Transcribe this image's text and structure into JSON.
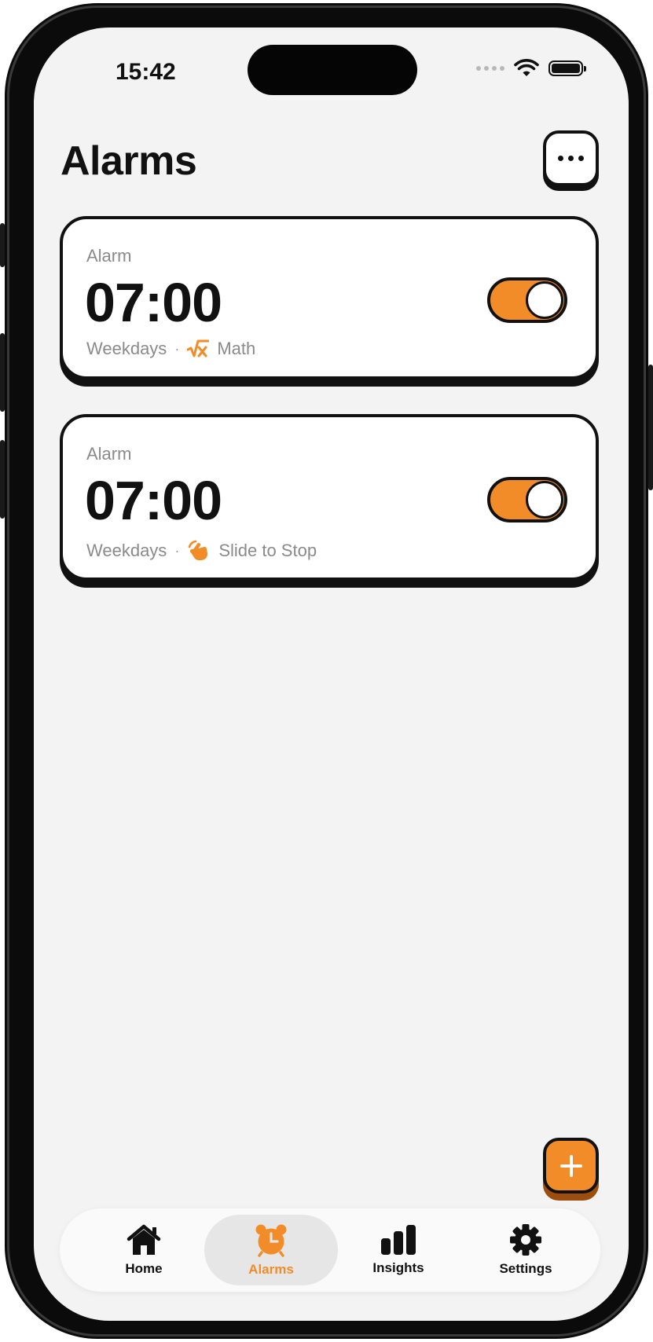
{
  "status_bar": {
    "time": "15:42"
  },
  "header": {
    "title": "Alarms"
  },
  "alarms": [
    {
      "label": "Alarm",
      "time": "07:00",
      "repeat": "Weekdays",
      "separator": "·",
      "mission": "Math",
      "mission_icon": "sqrt-x-icon",
      "enabled": true
    },
    {
      "label": "Alarm",
      "time": "07:00",
      "repeat": "Weekdays",
      "separator": "·",
      "mission": "Slide to Stop",
      "mission_icon": "swipe-hand-icon",
      "enabled": true
    }
  ],
  "tabs": [
    {
      "label": "Home",
      "icon": "house-icon",
      "active": false
    },
    {
      "label": "Alarms",
      "icon": "alarm-clock-icon",
      "active": true
    },
    {
      "label": "Insights",
      "icon": "bar-chart-icon",
      "active": false
    },
    {
      "label": "Settings",
      "icon": "gear-icon",
      "active": false
    }
  ],
  "colors": {
    "accent": "#f28c28",
    "background": "#f3f3f3",
    "ink": "#111111",
    "muted": "#8a8a8a"
  }
}
